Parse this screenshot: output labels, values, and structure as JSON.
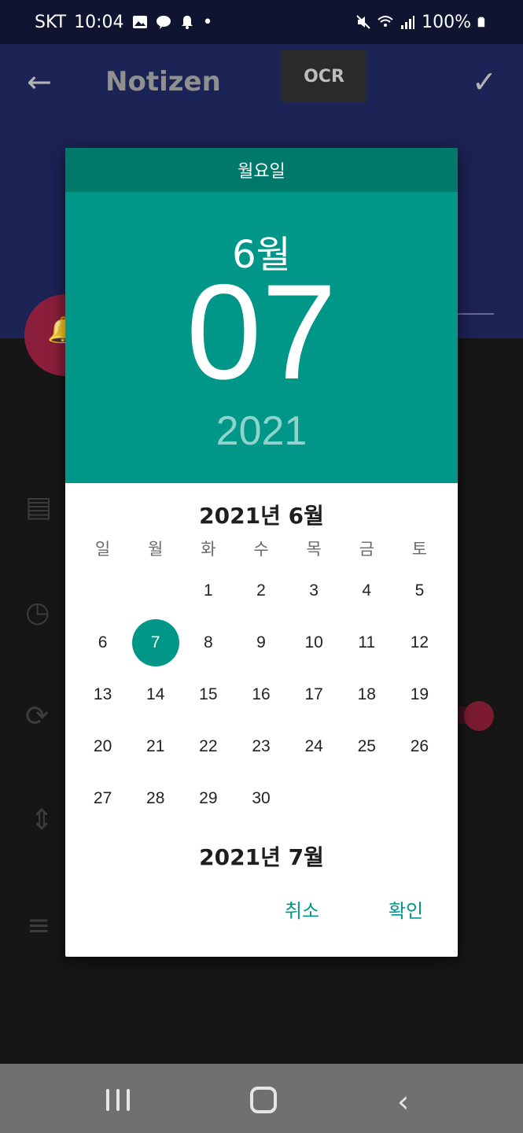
{
  "status_bar": {
    "carrier": "SKT",
    "time": "10:04",
    "battery": "100%",
    "icons": [
      "gallery-icon",
      "kakaotalk-icon",
      "notification-icon",
      "dot-icon",
      "mute-icon",
      "wifi-icon",
      "signal-icon",
      "battery-icon"
    ]
  },
  "background_app": {
    "title": "Notizen",
    "ocr_label": "OCR",
    "accent": "#1c2355"
  },
  "dialog": {
    "day_name": "월요일",
    "month_label": "6월",
    "day_number": "07",
    "year": "2021",
    "month_title": "2021년 6월",
    "next_month_title": "2021년 7월",
    "weekdays": [
      "일",
      "월",
      "화",
      "수",
      "목",
      "금",
      "토"
    ],
    "days": [
      "",
      "",
      "1",
      "2",
      "3",
      "4",
      "5",
      "6",
      "7",
      "8",
      "9",
      "10",
      "11",
      "12",
      "13",
      "14",
      "15",
      "16",
      "17",
      "18",
      "19",
      "20",
      "21",
      "22",
      "23",
      "24",
      "25",
      "26",
      "27",
      "28",
      "29",
      "30",
      "",
      "",
      ""
    ],
    "selected_day": "7",
    "cancel_label": "취소",
    "ok_label": "확인",
    "accent": "#009688",
    "header_dark": "#00796b"
  }
}
